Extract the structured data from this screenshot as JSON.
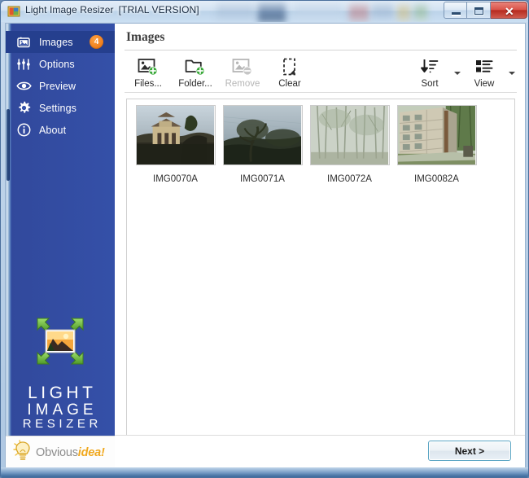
{
  "window": {
    "title": "Light Image Resizer",
    "trial_tag": "[TRIAL VERSION]",
    "icon": "app-image-resizer-icon",
    "controls": {
      "minimize": "minimize-icon",
      "maximize": "maximize-icon",
      "close": "close-icon",
      "close_glyph": "✕"
    }
  },
  "sidebar": {
    "items": [
      {
        "label": "Images",
        "icon": "photos-icon",
        "badge": "4",
        "active": true
      },
      {
        "label": "Options",
        "icon": "sliders-icon",
        "badge": "",
        "active": false
      },
      {
        "label": "Preview",
        "icon": "eye-icon",
        "badge": "",
        "active": false
      },
      {
        "label": "Settings",
        "icon": "gear-icon",
        "badge": "",
        "active": false
      },
      {
        "label": "About",
        "icon": "info-icon",
        "badge": "",
        "active": false
      }
    ],
    "brand": {
      "mark": "expand-arrows-photo-icon",
      "line1": "LIGHT",
      "line2": "IMAGE",
      "line3": "RESIZER"
    },
    "vendor": {
      "icon": "lightbulb-icon",
      "name_part1": "Obvious",
      "name_part2": "idea!"
    }
  },
  "main": {
    "page_title": "Images",
    "toolbar": {
      "left": [
        {
          "label": "Files...",
          "icon": "add-image-icon",
          "disabled": false
        },
        {
          "label": "Folder...",
          "icon": "add-folder-icon",
          "disabled": false
        },
        {
          "label": "Remove",
          "icon": "remove-image-icon",
          "disabled": true
        },
        {
          "label": "Clear",
          "icon": "clear-dashed-icon",
          "disabled": false
        }
      ],
      "right": [
        {
          "label": "Sort",
          "icon": "sort-descending-icon",
          "has_caret": true
        },
        {
          "label": "View",
          "icon": "list-view-icon",
          "has_caret": true
        }
      ]
    },
    "thumbnails": [
      {
        "caption": "IMG0070A",
        "scene": "villa-at-dusk"
      },
      {
        "caption": "IMG0071A",
        "scene": "tree-against-sky"
      },
      {
        "caption": "IMG0072A",
        "scene": "hazy-forest"
      },
      {
        "caption": "IMG0082A",
        "scene": "concrete-building"
      }
    ]
  },
  "footer": {
    "next_label": "Next >"
  },
  "colors": {
    "sidebar": "#3450a8",
    "sidebar_active": "#253f8e",
    "badge": "#ef7d1a",
    "vendor_accent": "#f0a81e",
    "next_border": "#5ca6c4",
    "close_button": "#c0392b"
  }
}
